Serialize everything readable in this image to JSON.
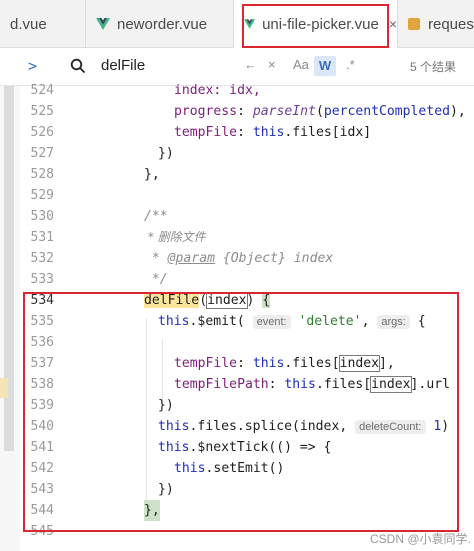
{
  "tabs": [
    {
      "label": "d.vue",
      "type": "vue",
      "active": false
    },
    {
      "label": "neworder.vue",
      "type": "vue",
      "active": false
    },
    {
      "label": "uni-file-picker.vue",
      "type": "vue",
      "active": true,
      "close": "×"
    },
    {
      "label": "reques",
      "type": "js",
      "active": false
    }
  ],
  "findbar": {
    "chevron": ">",
    "query": "delFile",
    "controls": [
      "←",
      "×",
      "Aa",
      "W",
      ".*"
    ],
    "results": "5 个结果"
  },
  "lines": [
    {
      "n": "524"
    },
    {
      "n": "525"
    },
    {
      "n": "526"
    },
    {
      "n": "527"
    },
    {
      "n": "528"
    },
    {
      "n": "529"
    },
    {
      "n": "530"
    },
    {
      "n": "531"
    },
    {
      "n": "532"
    },
    {
      "n": "533"
    },
    {
      "n": "534"
    },
    {
      "n": "535"
    },
    {
      "n": "536"
    },
    {
      "n": "537"
    },
    {
      "n": "538"
    },
    {
      "n": "539"
    },
    {
      "n": "540"
    },
    {
      "n": "541"
    },
    {
      "n": "542"
    },
    {
      "n": "543"
    },
    {
      "n": "544"
    },
    {
      "n": "545"
    }
  ],
  "code": {
    "l524": "index: idx,",
    "l525_prop": "progress",
    "l525_fn": "parseInt",
    "l525_arg": "percentCompleted",
    "l526_prop": "tempFile",
    "l526_this": "this",
    "l526_rest": ".files[idx]",
    "l527": "})",
    "l528": "},",
    "l530": "/**",
    "l531": " * 删除文件",
    "l532_tag": "@param",
    "l532_rest": " {Object} index",
    "l533": " */",
    "l534_fn": "delFile",
    "l534_arg": "index",
    "l535_this": "this",
    "l535_emit": ".$emit(",
    "l535_hint1": "event:",
    "l535_str": "'delete'",
    "l535_hint2": "args:",
    "l537_prop": "tempFile",
    "l537_this": "this",
    "l537_files": ".files[",
    "l537_idx": "index",
    "l538_prop": "tempFilePath",
    "l538_this": "this",
    "l538_files": ".files[",
    "l538_idx": "index",
    "l538_url": "].url",
    "l539": "})",
    "l540_this": "this",
    "l540_rest": ".files.splice(index,",
    "l540_hint": "deleteCount:",
    "l540_num": "1",
    "l541_this": "this",
    "l541_rest": ".$nextTick(() => {",
    "l542_this": "this",
    "l542_rest": ".setEmit()",
    "l543": "})",
    "l544": "},"
  },
  "watermark": "CSDN @小袁同学."
}
